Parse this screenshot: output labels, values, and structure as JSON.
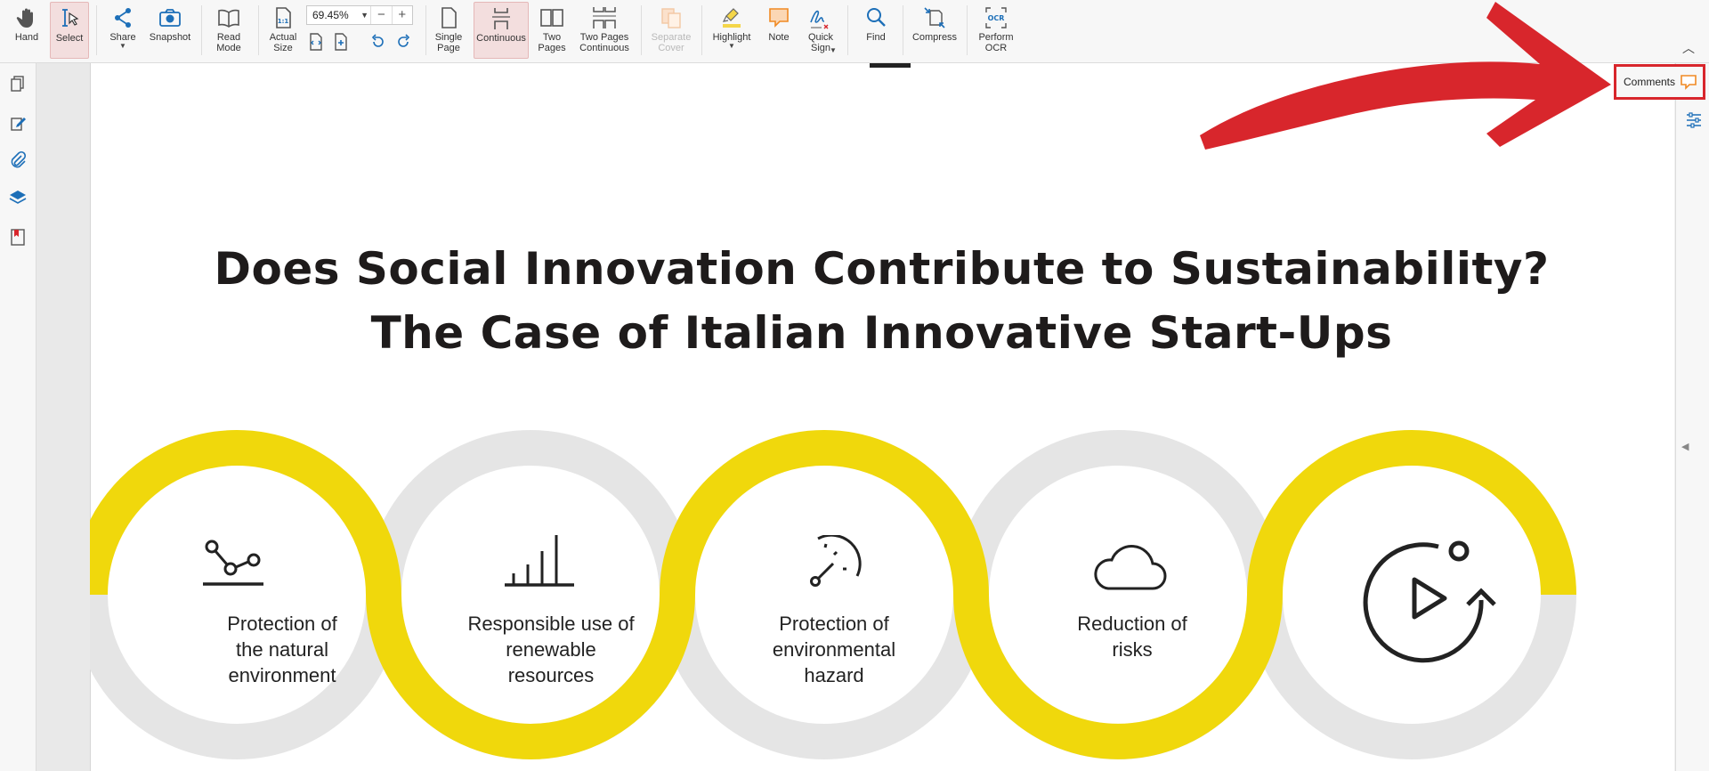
{
  "toolbar": {
    "hand": "Hand",
    "select": "Select",
    "share": "Share",
    "snapshot": "Snapshot",
    "read_mode": [
      "Read",
      "Mode"
    ],
    "actual_size": [
      "Actual",
      "Size"
    ],
    "zoom_value": "69.45%",
    "single_page": [
      "Single",
      "Page"
    ],
    "continuous": "Continuous",
    "two_pages": [
      "Two",
      "Pages"
    ],
    "two_pages_continuous": [
      "Two Pages",
      "Continuous"
    ],
    "separate_cover": [
      "Separate",
      "Cover"
    ],
    "highlight": "Highlight",
    "note": "Note",
    "quick_sign": [
      "Quick",
      "Sign"
    ],
    "find": "Find",
    "compress": "Compress",
    "perform_ocr": [
      "Perform",
      "OCR"
    ],
    "ocr_icon_text": "OCR"
  },
  "right_panel": {
    "comments": "Comments"
  },
  "document": {
    "title_line1": "Does Social Innovation Contribute to Sustainability?",
    "title_line2": "The Case of Italian Innovative Start-Ups",
    "rings": [
      {
        "label": [
          "Protection of",
          "the natural",
          "environment"
        ],
        "icon": "line-chart-nodes-icon",
        "color": "#f0d80c"
      },
      {
        "label": [
          "Responsible use of",
          "renewable",
          "resources"
        ],
        "icon": "bar-chart-icon",
        "color": "#e5e5e5"
      },
      {
        "label": [
          "Protection of",
          "environmental",
          "hazard"
        ],
        "icon": "gauge-icon",
        "color": "#f0d80c"
      },
      {
        "label": [
          "Reduction of",
          "risks"
        ],
        "icon": "cloud-icon",
        "color": "#e5e5e5"
      },
      {
        "label": [],
        "icon": "play-cycle-icon",
        "color": "#f0d80c"
      }
    ]
  },
  "colors": {
    "accent_yellow": "#f0d80c",
    "ring_gray": "#e5e5e5",
    "annotation_red": "#d8262c",
    "icon_blue": "#1d6fb8",
    "note_orange": "#f08a24"
  }
}
